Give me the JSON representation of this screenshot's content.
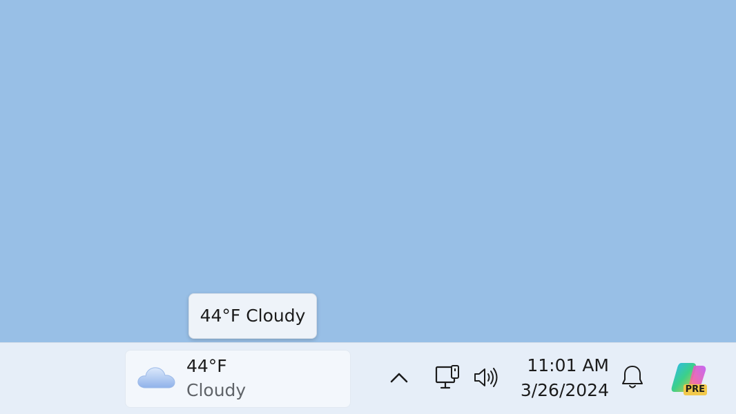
{
  "tooltip": {
    "text": "44°F Cloudy"
  },
  "weather": {
    "temperature": "44°F",
    "condition": "Cloudy",
    "icon": "cloud-icon"
  },
  "tray": {
    "chevron_icon": "chevron-up-icon",
    "network_icon": "network-icon",
    "volume_icon": "volume-icon",
    "bell_icon": "bell-icon"
  },
  "clock": {
    "time": "11:01 AM",
    "date": "3/26/2024"
  },
  "copilot": {
    "icon": "copilot-icon",
    "badge": "PRE"
  },
  "colors": {
    "desktop": "#98bfe6",
    "taskbar": "#e6eef8",
    "badge": "#f2c94c"
  }
}
